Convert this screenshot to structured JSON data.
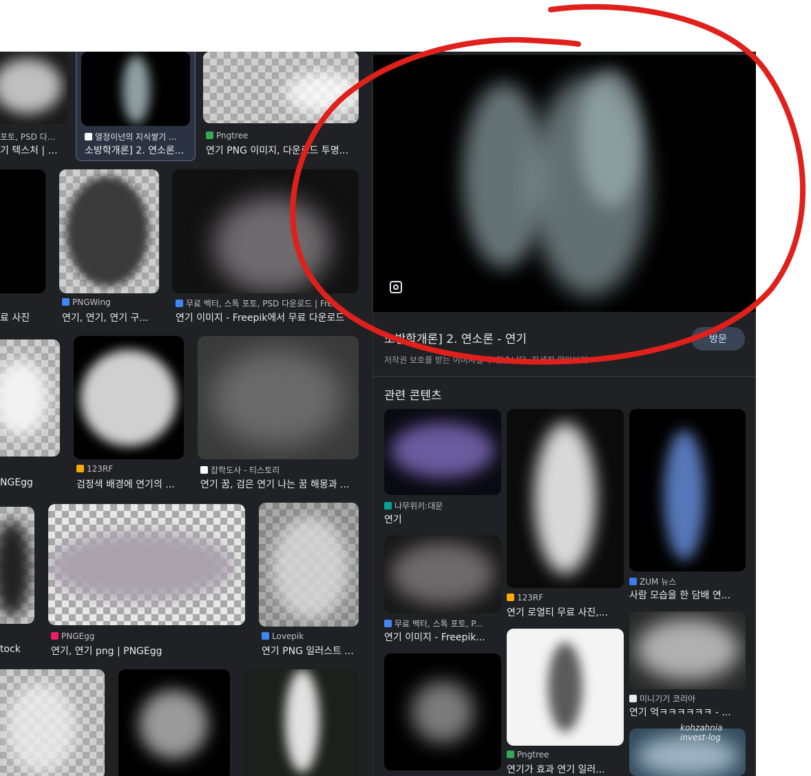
{
  "grid": {
    "row1": [
      {
        "source": "포토, PSD 다...",
        "title": "기 텍스처 | 프..."
      },
      {
        "source": "열정이넌의 지식쌓기 ...",
        "title": "소방학개론] 2. 연소론..."
      },
      {
        "source": "Pngtree",
        "title": "연기 PNG 이미지, 다운로드 투명..."
      }
    ],
    "row2": [
      {
        "source": "",
        "title": "료 사진"
      },
      {
        "source": "PNGWing",
        "title": "연기, 연기, 연기 구..."
      },
      {
        "source": "무료 벡터, 스톡 포토, PSD 다운로드 | Fre...",
        "title": "연기 이미지 - Freepik에서 무료 다운로드"
      }
    ],
    "row3": [
      {
        "source": "",
        "title": "NGEgg"
      },
      {
        "source": "123RF",
        "title": "검정색 배경에 연기의 ..."
      },
      {
        "source": "잡학도사 - 티스토리",
        "title": "연기 꿈, 검은 연기 나는 꿈 해몽과 ..."
      }
    ],
    "row4": [
      {
        "source": "",
        "title": "tock"
      },
      {
        "source": "PNGEgg",
        "title": "연기, 연기 png | PNGEgg"
      },
      {
        "source": "Lovepik",
        "title": "연기 PNG 일러스트 ..."
      }
    ]
  },
  "detail": {
    "title": "소방학개론] 2. 연소론 - 연기",
    "visit_label": "방문",
    "copyright": "저작권 보호를 받는 이미지일 수 있습니다. 자세히 알아보기",
    "related_heading": "관련 콘텐츠",
    "related": [
      {
        "source": "나무위키:대문",
        "title": "연기"
      },
      {
        "source": "123RF",
        "title": "연기 로열티 무료 사진,..."
      },
      {
        "source": "ZUM 뉴스",
        "title": "사람 모습을 한 담배 연..."
      },
      {
        "source": "무료 벡터, 스톡 포토, P...",
        "title": "연기 이미지 - Freepik..."
      },
      {
        "source": "미니기기 코리아",
        "title": "연기 억ㅋㅋㅋㅋㅋㅋ - ..."
      },
      {
        "source": "Pngtree",
        "title": "연기가 효과 연기 일러..."
      }
    ]
  },
  "watermark": "kohzahnia invest-log",
  "colors": {
    "accent_circle": "#e0201b",
    "panel_bg": "#202124",
    "visit_bg": "#394457"
  }
}
